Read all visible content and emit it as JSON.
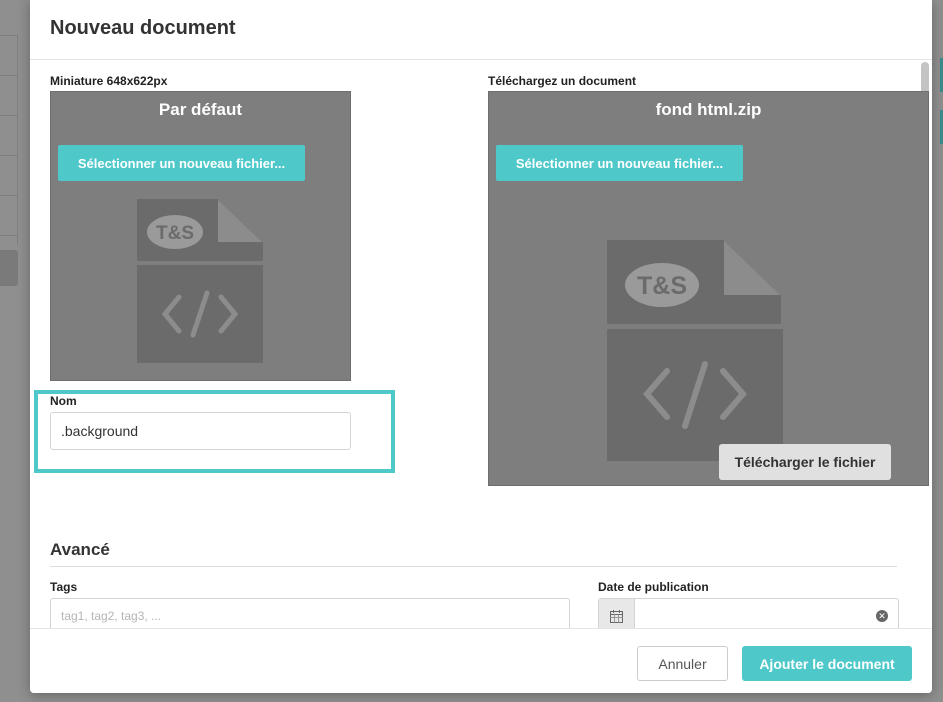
{
  "modal": {
    "title": "Nouveau document"
  },
  "thumbnail": {
    "label": "Miniature 648x622px",
    "title": "Par défaut",
    "select_label": "Sélectionner un nouveau fichier..."
  },
  "upload": {
    "label": "Téléchargez un document",
    "title": "fond html.zip",
    "select_label": "Sélectionner un nouveau fichier...",
    "download_label": "Télécharger le fichier"
  },
  "name_field": {
    "label": "Nom",
    "value": ".background"
  },
  "advanced": {
    "title": "Avancé",
    "tags_label": "Tags",
    "tags_placeholder": "tag1, tag2, tag3, ...",
    "date_label": "Date de publication",
    "date_value": ""
  },
  "footer": {
    "cancel_label": "Annuler",
    "add_label": "Ajouter le document"
  },
  "file_icon_badge": "T&S",
  "colors": {
    "accent": "#4fc8ca",
    "preview_bg": "#7e7e7e",
    "highlight": "#4fc8ca"
  }
}
